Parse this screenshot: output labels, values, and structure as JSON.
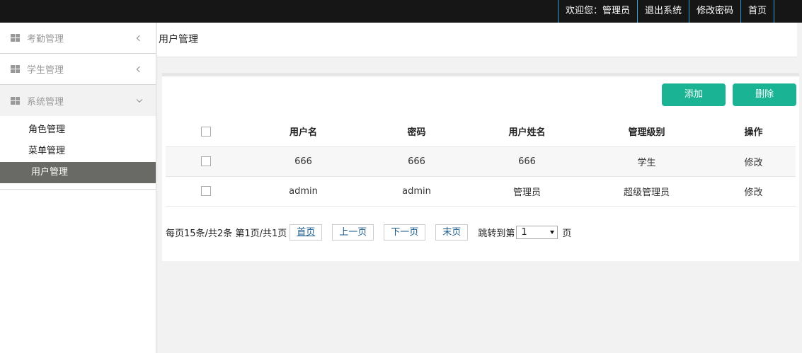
{
  "topnav": {
    "welcome": "欢迎您：管理员",
    "logout": "退出系统",
    "change_password": "修改密码",
    "home": "首页"
  },
  "sidebar": {
    "groups": [
      {
        "label": "考勤管理"
      },
      {
        "label": "学生管理"
      },
      {
        "label": "系统管理"
      }
    ],
    "sub_items": [
      {
        "label": "角色管理"
      },
      {
        "label": "菜单管理"
      },
      {
        "label": "用户管理"
      }
    ]
  },
  "page": {
    "title": "用户管理"
  },
  "toolbar": {
    "add_label": "添加",
    "delete_label": "删除"
  },
  "table": {
    "headers": [
      "用户名",
      "密码",
      "用户姓名",
      "管理级别",
      "操作"
    ],
    "rows": [
      {
        "username": "666",
        "password": "666",
        "name": "666",
        "level": "学生",
        "action": "修改"
      },
      {
        "username": "admin",
        "password": "admin",
        "name": "管理员",
        "level": "超级管理员",
        "action": "修改"
      }
    ]
  },
  "pager": {
    "summary": "每页15条/共2条 第1页/共1页",
    "first": "首页",
    "prev": "上一页",
    "next": "下一页",
    "last": "末页",
    "jump_prefix": "跳转到第",
    "page_value": "1",
    "jump_suffix": "页"
  },
  "colors": {
    "topbar": "#161616",
    "accent": "#1ab394",
    "active_item": "#696a65",
    "nav_divider": "#2a9fd6"
  }
}
